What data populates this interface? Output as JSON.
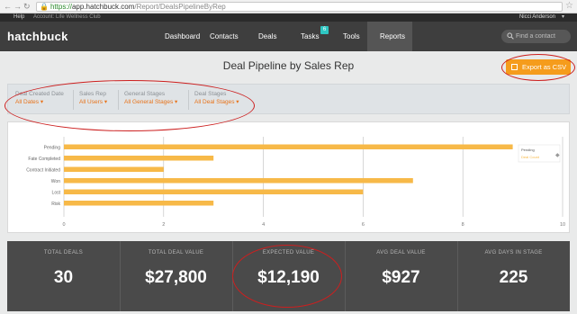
{
  "browser": {
    "url_secure": "https://",
    "url_host": "app.hatchbuck.com",
    "url_path": "/Report/DealsPipelineByRep"
  },
  "app_strip": {
    "help": "Help",
    "account": "Account: Life Wellness Club",
    "user": "Nicci Anderson"
  },
  "nav": {
    "logo": "hatchbuck",
    "items": [
      "Dashboard",
      "Contacts",
      "Deals",
      "Tasks",
      "Tools",
      "Reports"
    ],
    "tasks_badge": "6",
    "active": "Reports",
    "search_placeholder": "Find a contact"
  },
  "page": {
    "title": "Deal Pipeline by Sales Rep",
    "export_label": "Export as CSV"
  },
  "filters": [
    {
      "label": "Deal Created Date",
      "value": "All Dates"
    },
    {
      "label": "Sales Rep",
      "value": "All Users"
    },
    {
      "label": "General Stages",
      "value": "All General Stages"
    },
    {
      "label": "Deal Stages",
      "value": "All Deal Stages"
    }
  ],
  "chart_data": {
    "type": "bar",
    "orientation": "horizontal",
    "categories": [
      "Pending",
      "Fate Completed",
      "Contract Initiated",
      "Won",
      "Lost",
      "Risk"
    ],
    "values": [
      9,
      3,
      2,
      7,
      6,
      3
    ],
    "xlim": [
      0,
      10
    ],
    "xticks": [
      0,
      2,
      4,
      6,
      8,
      10
    ],
    "grid": true,
    "bar_color": "#f7b948",
    "legend": {
      "placement": "right",
      "entries": [
        "Pending",
        "Deal Count"
      ]
    }
  },
  "stats": [
    {
      "label": "TOTAL DEALS",
      "value": "30"
    },
    {
      "label": "TOTAL DEAL VALUE",
      "value": "$27,800"
    },
    {
      "label": "EXPECTED VALUE",
      "value": "$12,190"
    },
    {
      "label": "AVG DEAL VALUE",
      "value": "$927"
    },
    {
      "label": "AVG DAYS IN STAGE",
      "value": "225"
    }
  ],
  "colors": {
    "accent": "#f59c1c",
    "filter_value": "#e8731a",
    "annotation": "#cc1f1f",
    "badge": "#2ec6c2"
  }
}
